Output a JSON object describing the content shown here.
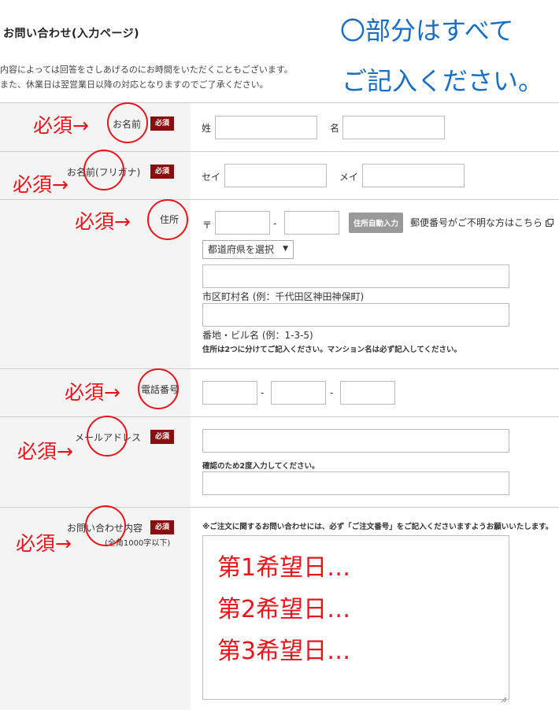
{
  "page": {
    "title": "お問い合わせ(入力ページ)",
    "intro_line1": "内容によっては回答をさしあげるのにお時間をいただくこともございます。",
    "intro_line2": "また、休業日は翌営業日以降の対応となりますのでご了承ください。",
    "annotation_line1": "〇部分はすべて",
    "annotation_line2": "ご記入ください。"
  },
  "required_tag": "必須",
  "required_arrow": "必須→",
  "form": {
    "name": {
      "label": "お名前",
      "last_label": "姓",
      "first_label": "名"
    },
    "kana": {
      "label": "お名前(フリガナ)",
      "last_label": "セイ",
      "first_label": "メイ"
    },
    "address": {
      "label": "住所",
      "postal_mark": "〒",
      "dash": "-",
      "auto_button": "住所自動入力",
      "postal_link": "郵便番号がご不明な方はこちら",
      "prefecture_select": "都道府県を選択",
      "city_hint": "市区町村名 (例：千代田区神田神保町)",
      "street_hint": "番地・ビル名 (例：1-3-5)",
      "note": "住所は2つに分けてご記入ください。マンション名は必ず記入してください。"
    },
    "phone": {
      "label": "電話番号",
      "dash": "-"
    },
    "email": {
      "label": "メールアドレス",
      "confirm_note": "確認のため2度入力してください。"
    },
    "inquiry": {
      "label": "お問い合わせ内容",
      "sublabel": "(全角1000字以下)",
      "note": "※ご注文に関するお問い合わせには、必ず「ご注文番号」をご記入くださいますようお願いいたします。",
      "line1": "第1希望日…",
      "line2": "第2希望日…",
      "line3": "第3希望日…"
    }
  }
}
